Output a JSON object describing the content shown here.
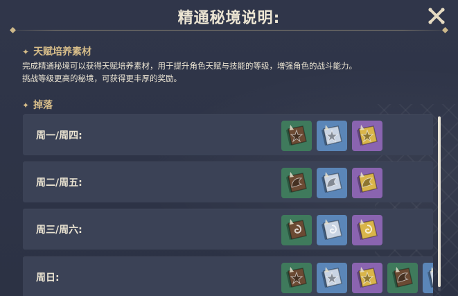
{
  "dialog": {
    "title": "精通秘境说明:",
    "close_label": "关闭"
  },
  "sections": [
    {
      "heading": "天赋培养素材",
      "lines": [
        "完成精通秘境可以获得天赋培养素材，用于提升角色天赋与技能的等级，增强角色的战斗能力。",
        "挑战等级更高的秘境，可获得更丰厚的奖励。"
      ]
    },
    {
      "heading": "掉落"
    }
  ],
  "drops": [
    {
      "day": "周一/周四:",
      "items": [
        {
          "rarity": "green",
          "icon": "talent-book-icon",
          "symbol": "star"
        },
        {
          "rarity": "blue",
          "icon": "talent-book-icon",
          "symbol": "star"
        },
        {
          "rarity": "purple",
          "icon": "talent-book-icon",
          "symbol": "star"
        }
      ]
    },
    {
      "day": "周二/周五:",
      "items": [
        {
          "rarity": "green",
          "icon": "talent-book-icon",
          "symbol": "wing"
        },
        {
          "rarity": "blue",
          "icon": "talent-book-icon",
          "symbol": "wing"
        },
        {
          "rarity": "purple",
          "icon": "talent-book-icon",
          "symbol": "wing"
        }
      ]
    },
    {
      "day": "周三/周六:",
      "items": [
        {
          "rarity": "green",
          "icon": "talent-book-icon",
          "symbol": "swirl"
        },
        {
          "rarity": "blue",
          "icon": "talent-book-icon",
          "symbol": "swirl"
        },
        {
          "rarity": "purple",
          "icon": "talent-book-icon",
          "symbol": "swirl"
        }
      ]
    },
    {
      "day": "周日:",
      "items": [
        {
          "rarity": "green",
          "icon": "talent-book-icon",
          "symbol": "star"
        },
        {
          "rarity": "blue",
          "icon": "talent-book-icon",
          "symbol": "star"
        },
        {
          "rarity": "purple",
          "icon": "talent-book-icon",
          "symbol": "star"
        },
        {
          "rarity": "green",
          "icon": "talent-book-icon",
          "symbol": "wing"
        },
        {
          "rarity": "blue",
          "icon": "talent-book-icon",
          "symbol": "wing"
        }
      ]
    }
  ],
  "colors": {
    "green": "#3f7a5c",
    "blue": "#5b86b8",
    "purple": "#8a64b0",
    "accent": "#d8be8a",
    "text": "#ece5d3"
  }
}
